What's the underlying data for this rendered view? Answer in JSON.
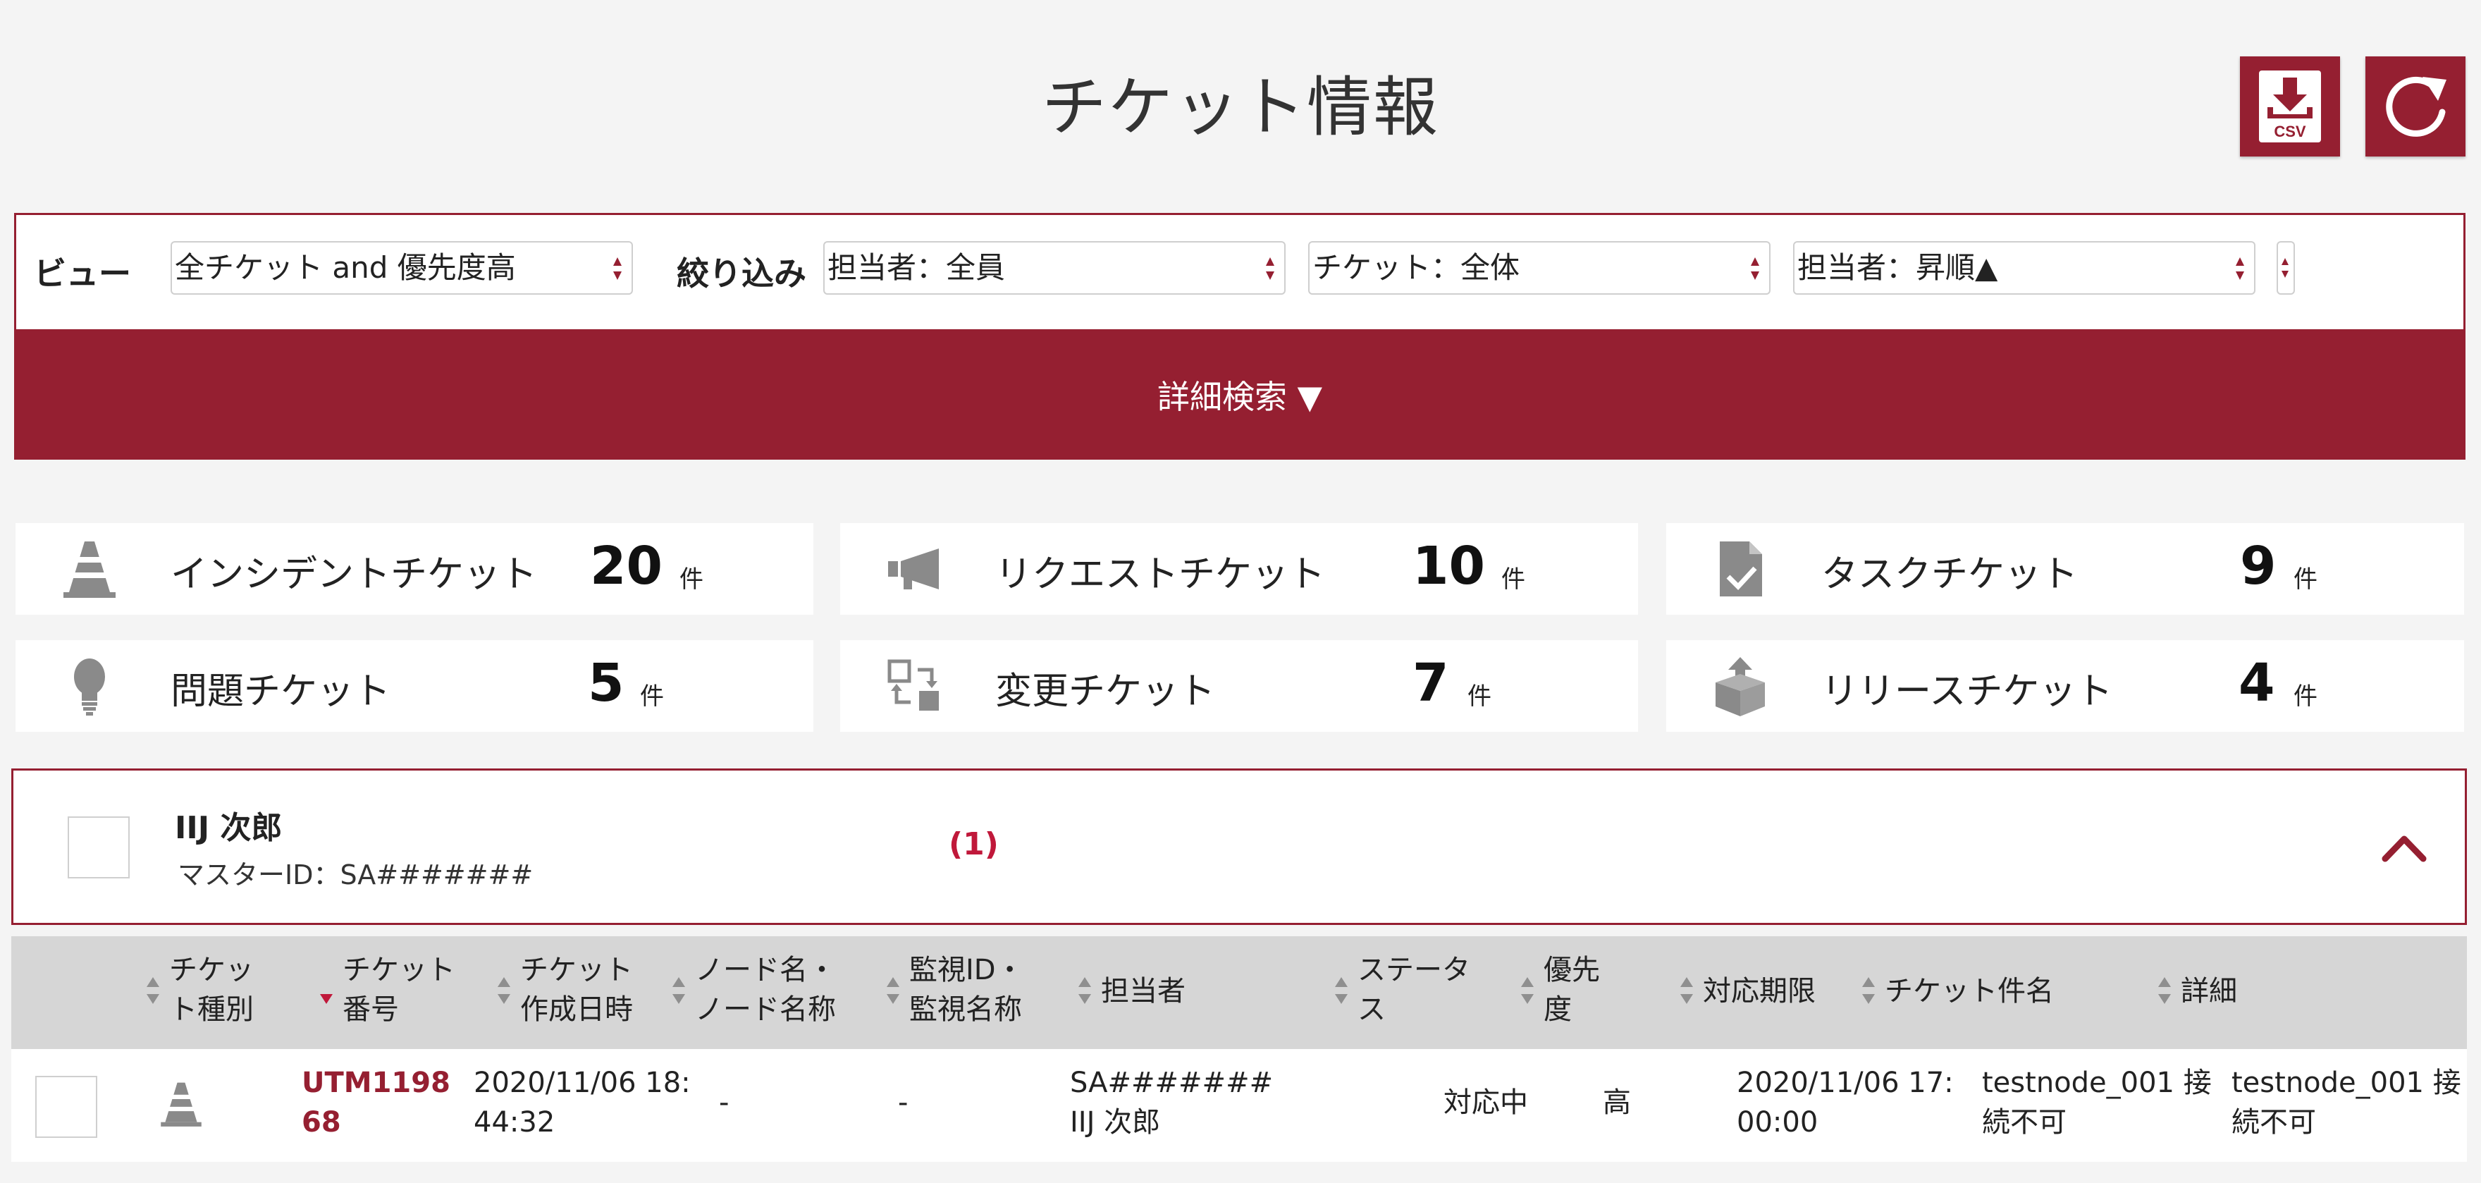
{
  "header": {
    "title": "チケット情報",
    "csv_label": "CSV"
  },
  "filters": {
    "view_label": "ビュー",
    "view_value": "全チケット and 優先度高",
    "narrow_label": "絞り込み",
    "selects": [
      "担当者：全員",
      "チケット：全体",
      "担当者：昇順▲"
    ],
    "detail_search": "詳細検索 ▼"
  },
  "summary": [
    {
      "label": "インシデントチケット",
      "count": "20",
      "unit": "件",
      "icon": "traffic-cone-icon"
    },
    {
      "label": "リクエストチケット",
      "count": "10",
      "unit": "件",
      "icon": "megaphone-icon"
    },
    {
      "label": "タスクチケット",
      "count": "9",
      "unit": "件",
      "icon": "task-document-icon"
    },
    {
      "label": "問題チケット",
      "count": "5",
      "unit": "件",
      "icon": "lightbulb-icon"
    },
    {
      "label": "変更チケット",
      "count": "7",
      "unit": "件",
      "icon": "change-arrows-icon"
    },
    {
      "label": "リリースチケット",
      "count": "4",
      "unit": "件",
      "icon": "release-box-icon"
    }
  ],
  "group": {
    "name": "IIJ 次郎",
    "master_id": "マスターID：SA#######",
    "count": "(1)"
  },
  "table": {
    "columns": [
      [
        "チケッ",
        "ト種別"
      ],
      [
        "チケット",
        "番号"
      ],
      [
        "チケット",
        "作成日時"
      ],
      [
        "ノード名・",
        "ノード名称"
      ],
      [
        "監視ID・",
        "監視名称"
      ],
      [
        "担当者"
      ],
      [
        "ステータ",
        "ス"
      ],
      [
        "優先",
        "度"
      ],
      [
        "対応期限"
      ],
      [
        "チケット件名"
      ],
      [
        "詳細"
      ]
    ],
    "rows": [
      {
        "ticket_no": [
          "UTM1198",
          "68"
        ],
        "created": [
          "2020/11/06 18:",
          "44:32"
        ],
        "node": "-",
        "monitor": "-",
        "assignee": [
          "SA#######",
          "IIJ 次郎"
        ],
        "status": "対応中",
        "priority": "高",
        "deadline": [
          "2020/11/06 17:",
          "00:00"
        ],
        "subject": [
          "testnode_001 接",
          "続不可"
        ],
        "detail": [
          "testnode_001 接",
          "続不可"
        ]
      }
    ]
  },
  "colors": {
    "accent": "#951f31",
    "link": "#951f31",
    "background": "#f4f4f4",
    "icon_gray": "#8a8a8a"
  }
}
